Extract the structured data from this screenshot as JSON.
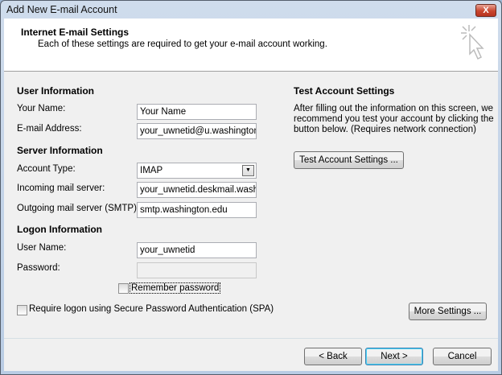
{
  "window": {
    "title": "Add New E-mail Account",
    "close_label": "X"
  },
  "header": {
    "title": "Internet E-mail Settings",
    "subtitle": "Each of these settings are required to get your e-mail account working."
  },
  "user_info": {
    "heading": "User Information",
    "your_name_label": "Your Name:",
    "your_name_value": "Your Name",
    "email_label": "E-mail Address:",
    "email_value": "your_uwnetid@u.washington.edu"
  },
  "server_info": {
    "heading": "Server Information",
    "account_type_label": "Account Type:",
    "account_type_value": "IMAP",
    "incoming_label": "Incoming mail server:",
    "incoming_value": "your_uwnetid.deskmail.washington.edu",
    "outgoing_label": "Outgoing mail server (SMTP):",
    "outgoing_value": "smtp.washington.edu"
  },
  "logon_info": {
    "heading": "Logon Information",
    "username_label": "User Name:",
    "username_value": "your_uwnetid",
    "password_label": "Password:",
    "password_value": "",
    "remember_label": "Remember password",
    "remember_checked": false,
    "spa_label": "Require logon using Secure Password Authentication (SPA)",
    "spa_checked": false
  },
  "test": {
    "heading": "Test Account Settings",
    "description": "After filling out the information on this screen, we recommend you test your account by clicking the button below. (Requires network connection)",
    "button": "Test Account Settings ..."
  },
  "buttons": {
    "more_settings": "More Settings ...",
    "back": "< Back",
    "next": "Next >",
    "cancel": "Cancel"
  }
}
